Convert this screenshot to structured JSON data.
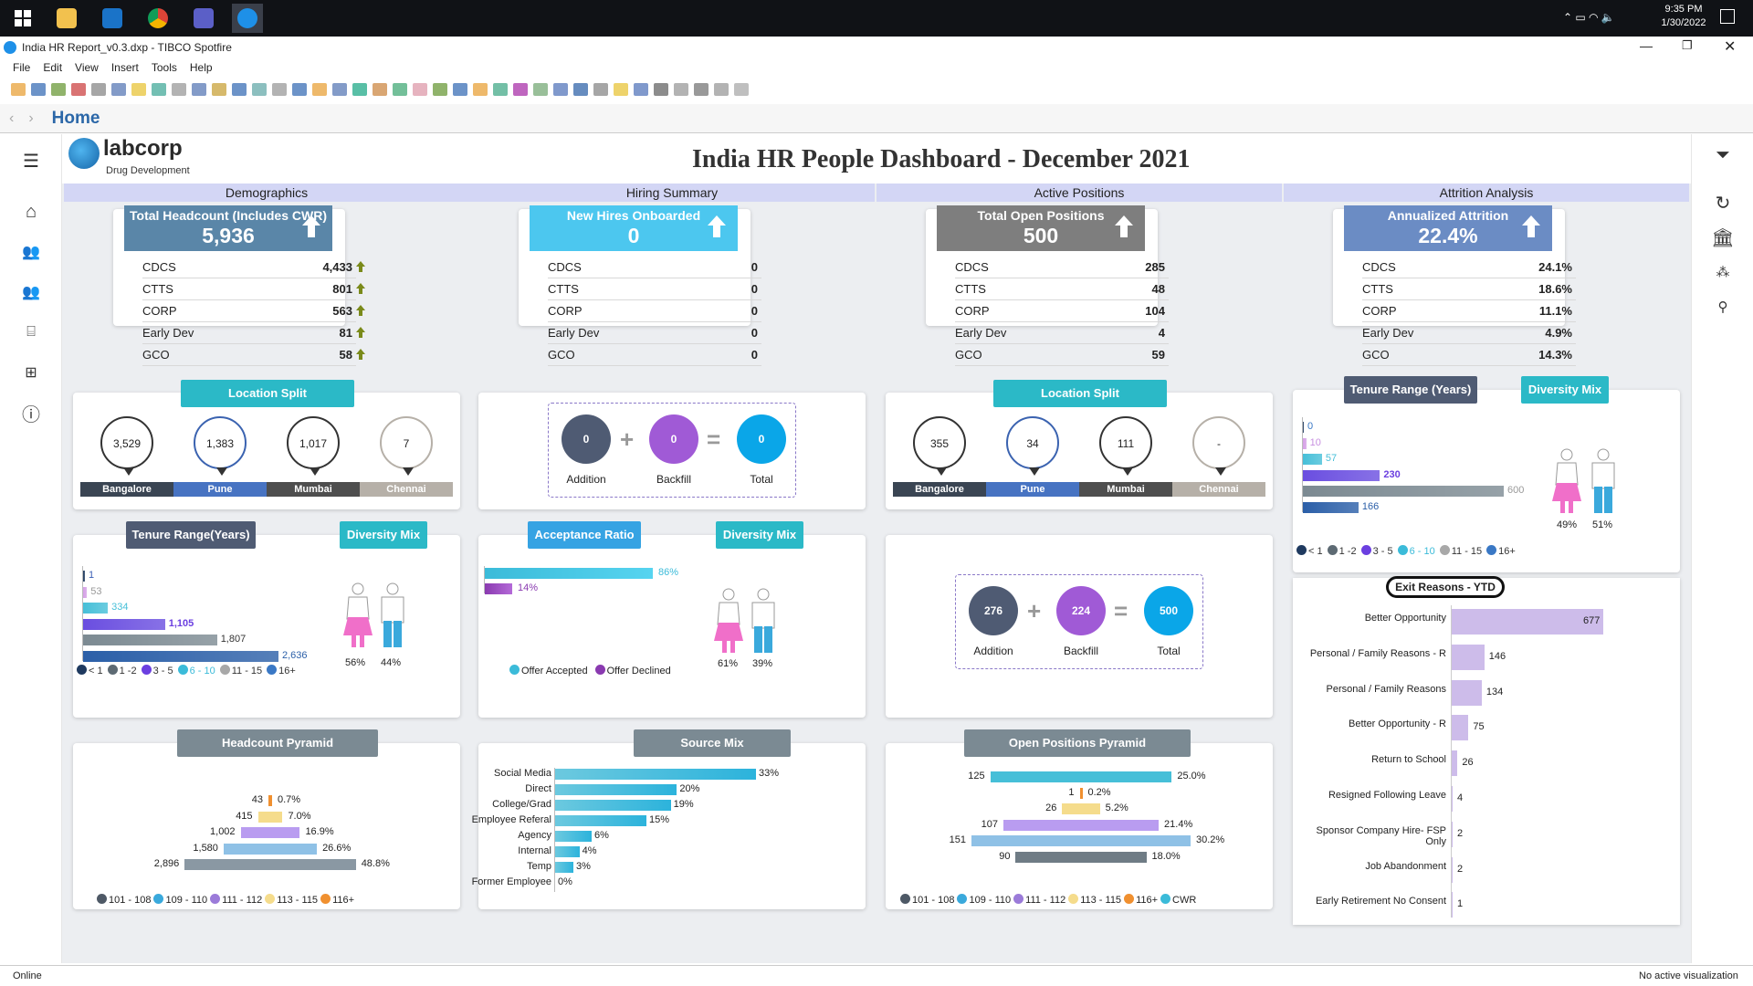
{
  "taskbar": {
    "time": "9:35 PM",
    "date": "1/30/2022"
  },
  "window": {
    "title": "India HR Report_v0.3.dxp - TIBCO Spotfire"
  },
  "menu": [
    "File",
    "Edit",
    "View",
    "Insert",
    "Tools",
    "Help"
  ],
  "nav": {
    "home": "Home"
  },
  "brand": {
    "name": "labcorp",
    "sub": "Drug Development"
  },
  "dashboard": {
    "title": "India HR People Dashboard - December 2021"
  },
  "sections": [
    "Demographics",
    "Hiring Summary",
    "Active Positions",
    "Attrition Analysis"
  ],
  "kpis": [
    {
      "label": "Total Headcount (Includes CWR)",
      "value": "5,936",
      "color": "#5a86a8",
      "rows": [
        [
          "CDCS",
          "4,433"
        ],
        [
          "CTTS",
          "801"
        ],
        [
          "CORP",
          "563"
        ],
        [
          "Early Dev",
          "81"
        ],
        [
          "GCO",
          "58"
        ]
      ]
    },
    {
      "label": "New Hires Onboarded",
      "value": "0",
      "color": "#4cc7ef",
      "rows": [
        [
          "CDCS",
          "0"
        ],
        [
          "CTTS",
          "0"
        ],
        [
          "CORP",
          "0"
        ],
        [
          "Early Dev",
          "0"
        ],
        [
          "GCO",
          "0"
        ]
      ]
    },
    {
      "label": "Total Open Positions",
      "value": "500",
      "color": "#7e7e7e",
      "rows": [
        [
          "CDCS",
          "285"
        ],
        [
          "CTTS",
          "48"
        ],
        [
          "CORP",
          "104"
        ],
        [
          "Early Dev",
          "4"
        ],
        [
          "GCO",
          "59"
        ]
      ]
    },
    {
      "label": "Annualized Attrition",
      "value": "22.4%",
      "color": "#6b8cc4",
      "rows": [
        [
          "CDCS",
          "24.1%"
        ],
        [
          "CTTS",
          "18.6%"
        ],
        [
          "CORP",
          "11.1%"
        ],
        [
          "Early Dev",
          "4.9%"
        ],
        [
          "GCO",
          "14.3%"
        ]
      ]
    }
  ],
  "buttons": {
    "location_split": "Location Split",
    "tenure_range": "Tenure Range(Years)",
    "tenure_range_attr": "Tenure Range (Years)",
    "diversity_mix": "Diversity Mix",
    "acceptance_ratio": "Acceptance Ratio",
    "headcount_pyramid": "Headcount Pyramid",
    "source_mix": "Source Mix",
    "open_positions_pyramid": "Open Positions Pyramid",
    "exit_reasons": "Exit Reasons - YTD"
  },
  "locations_demo": [
    {
      "city": "Bangalore",
      "value": "3,529"
    },
    {
      "city": "Pune",
      "value": "1,383"
    },
    {
      "city": "Mumbai",
      "value": "1,017"
    },
    {
      "city": "Chennai",
      "value": "7"
    }
  ],
  "locations_open": [
    {
      "city": "Bangalore",
      "value": "355"
    },
    {
      "city": "Pune",
      "value": "34"
    },
    {
      "city": "Mumbai",
      "value": "111"
    },
    {
      "city": "Chennai",
      "value": "-"
    }
  ],
  "hiring_formula": {
    "addition": "0",
    "backfill": "0",
    "total": "0"
  },
  "open_formula": {
    "addition": "276",
    "backfill": "224",
    "total": "500"
  },
  "formula_labels": {
    "addition": "Addition",
    "backfill": "Backfill",
    "total": "Total"
  },
  "diversity": {
    "demographics": {
      "female": "56%",
      "male": "44%"
    },
    "hiring": {
      "female": "61%",
      "male": "39%"
    },
    "attrition": {
      "female": "49%",
      "male": "51%"
    }
  },
  "acceptance": {
    "accepted": "86%",
    "declined": "14%",
    "legend_accepted": "Offer Accepted",
    "legend_declined": "Offer Declined"
  },
  "tenure_legend": [
    "< 1",
    "1 -2",
    "3 - 5",
    "6 - 10",
    "11 - 15",
    "16+"
  ],
  "pyramid_legend": [
    "101 - 108",
    "109 - 110",
    "111 - 112",
    "113 - 115",
    "116+"
  ],
  "cwr_legend": "CWR",
  "colors": {
    "c_lt1": "#1f3a5f",
    "c_1_2": "#5d6a73",
    "c_3_5": "#6b3fe0",
    "c_6_10": "#3bbbd9",
    "c_11_15": "#a8a8a8",
    "c_16": "#3a78c5",
    "female": "#f06fc9",
    "male": "#3aa9dc"
  },
  "chart_data": [
    {
      "type": "bar",
      "title": "Tenure Range(Years)",
      "categories": [
        "< 1",
        "1 -2",
        "3 - 5",
        "6 - 10",
        "11 - 15",
        "16+"
      ],
      "values": [
        1,
        53,
        334,
        1105,
        1807,
        2636
      ]
    },
    {
      "type": "bar",
      "title": "Acceptance Ratio",
      "categories": [
        "Offer Accepted",
        "Offer Declined"
      ],
      "values": [
        86,
        14
      ]
    },
    {
      "type": "bar",
      "title": "Headcount Pyramid",
      "categories": [
        "116+",
        "113 - 115",
        "111 - 112",
        "109 - 110",
        "101 - 108"
      ],
      "series": [
        {
          "name": "count",
          "values": [
            43,
            415,
            1002,
            1580,
            2896
          ]
        },
        {
          "name": "pct",
          "values": [
            0.7,
            7.0,
            16.9,
            26.6,
            48.8
          ]
        }
      ]
    },
    {
      "type": "bar",
      "title": "Source Mix",
      "categories": [
        "Social Media",
        "Direct",
        "College/Grad",
        "Employee Referal",
        "Agency",
        "Internal",
        "Temp",
        "Former Employee"
      ],
      "values": [
        33,
        20,
        19,
        15,
        6,
        4,
        3,
        0
      ]
    },
    {
      "type": "bar",
      "title": "Open Positions Pyramid",
      "categories": [
        "CWR",
        "116+",
        "113 - 115",
        "111 - 112",
        "109 - 110",
        "101 - 108"
      ],
      "series": [
        {
          "name": "count",
          "values": [
            125,
            1,
            26,
            107,
            151,
            90
          ]
        },
        {
          "name": "pct",
          "values": [
            25.0,
            0.2,
            5.2,
            21.4,
            30.2,
            18.0
          ]
        }
      ]
    },
    {
      "type": "bar",
      "title": "Tenure Range (Years)",
      "categories": [
        "< 1",
        "1 -2",
        "3 - 5",
        "6 - 10",
        "11 - 15",
        "16+"
      ],
      "values": [
        0,
        10,
        57,
        230,
        600,
        166
      ]
    },
    {
      "type": "bar",
      "title": "Exit Reasons - YTD",
      "categories": [
        "Better Opportunity",
        "Personal / Family Reasons - R",
        "Personal / Family Reasons",
        "Better Opportunity - R",
        "Return to School",
        "Resigned Following Leave",
        "Sponsor Company Hire- FSP Only",
        "Job Abandonment",
        "Early Retirement No Consent"
      ],
      "values": [
        677,
        146,
        134,
        75,
        26,
        4,
        2,
        2,
        1
      ]
    }
  ],
  "status": {
    "left": "Online",
    "right": "No active visualization"
  }
}
